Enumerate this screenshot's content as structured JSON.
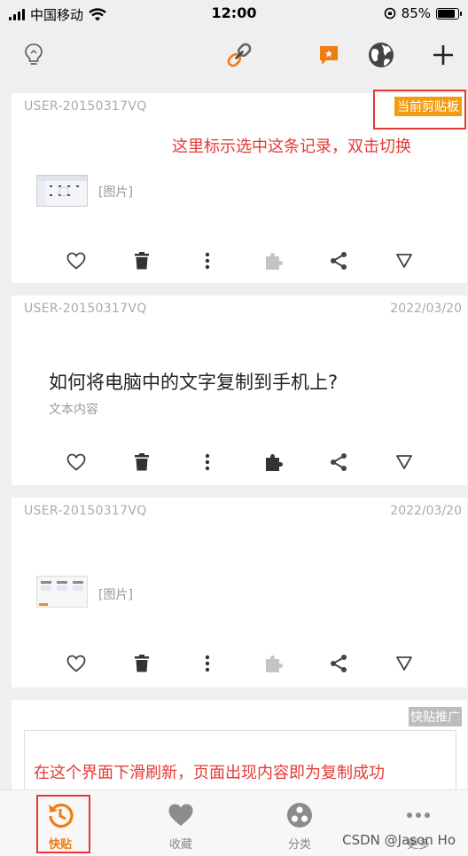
{
  "status_bar": {
    "carrier": "中国移动",
    "time": "12:00",
    "battery": "85%",
    "battery_level": 0.85
  },
  "toolbar": {
    "icons": [
      "bulb-icon",
      "link-icon",
      "new-note-icon",
      "globe-icon",
      "add-icon"
    ],
    "accent_color": "#f07d12"
  },
  "cards": [
    {
      "user": "USER-20150317VQ",
      "badge": "当前剪贴板",
      "content_label": "[图片]"
    },
    {
      "user": "USER-20150317VQ",
      "date": "2022/03/20",
      "title": "如何将电脑中的文字复制到手机上?",
      "subtitle": "文本内容"
    },
    {
      "user": "USER-20150317VQ",
      "date": "2022/03/20",
      "content_label": "[图片]"
    }
  ],
  "ad_card": {
    "badge": "快贴推广"
  },
  "annotations": {
    "top": "这里标示选中这条记录，双击切换",
    "bottom": "在这个界面下滑刷新，页面出现内容即为复制成功",
    "color": "#e53935"
  },
  "tabbar": {
    "tabs": [
      {
        "label": "快贴",
        "icon": "history-icon",
        "active": true
      },
      {
        "label": "收藏",
        "icon": "heart-icon",
        "active": false
      },
      {
        "label": "分类",
        "icon": "category-icon",
        "active": false
      },
      {
        "label": "更多",
        "icon": "more-icon",
        "active": false
      }
    ]
  },
  "watermark": "CSDN @Jason Ho"
}
